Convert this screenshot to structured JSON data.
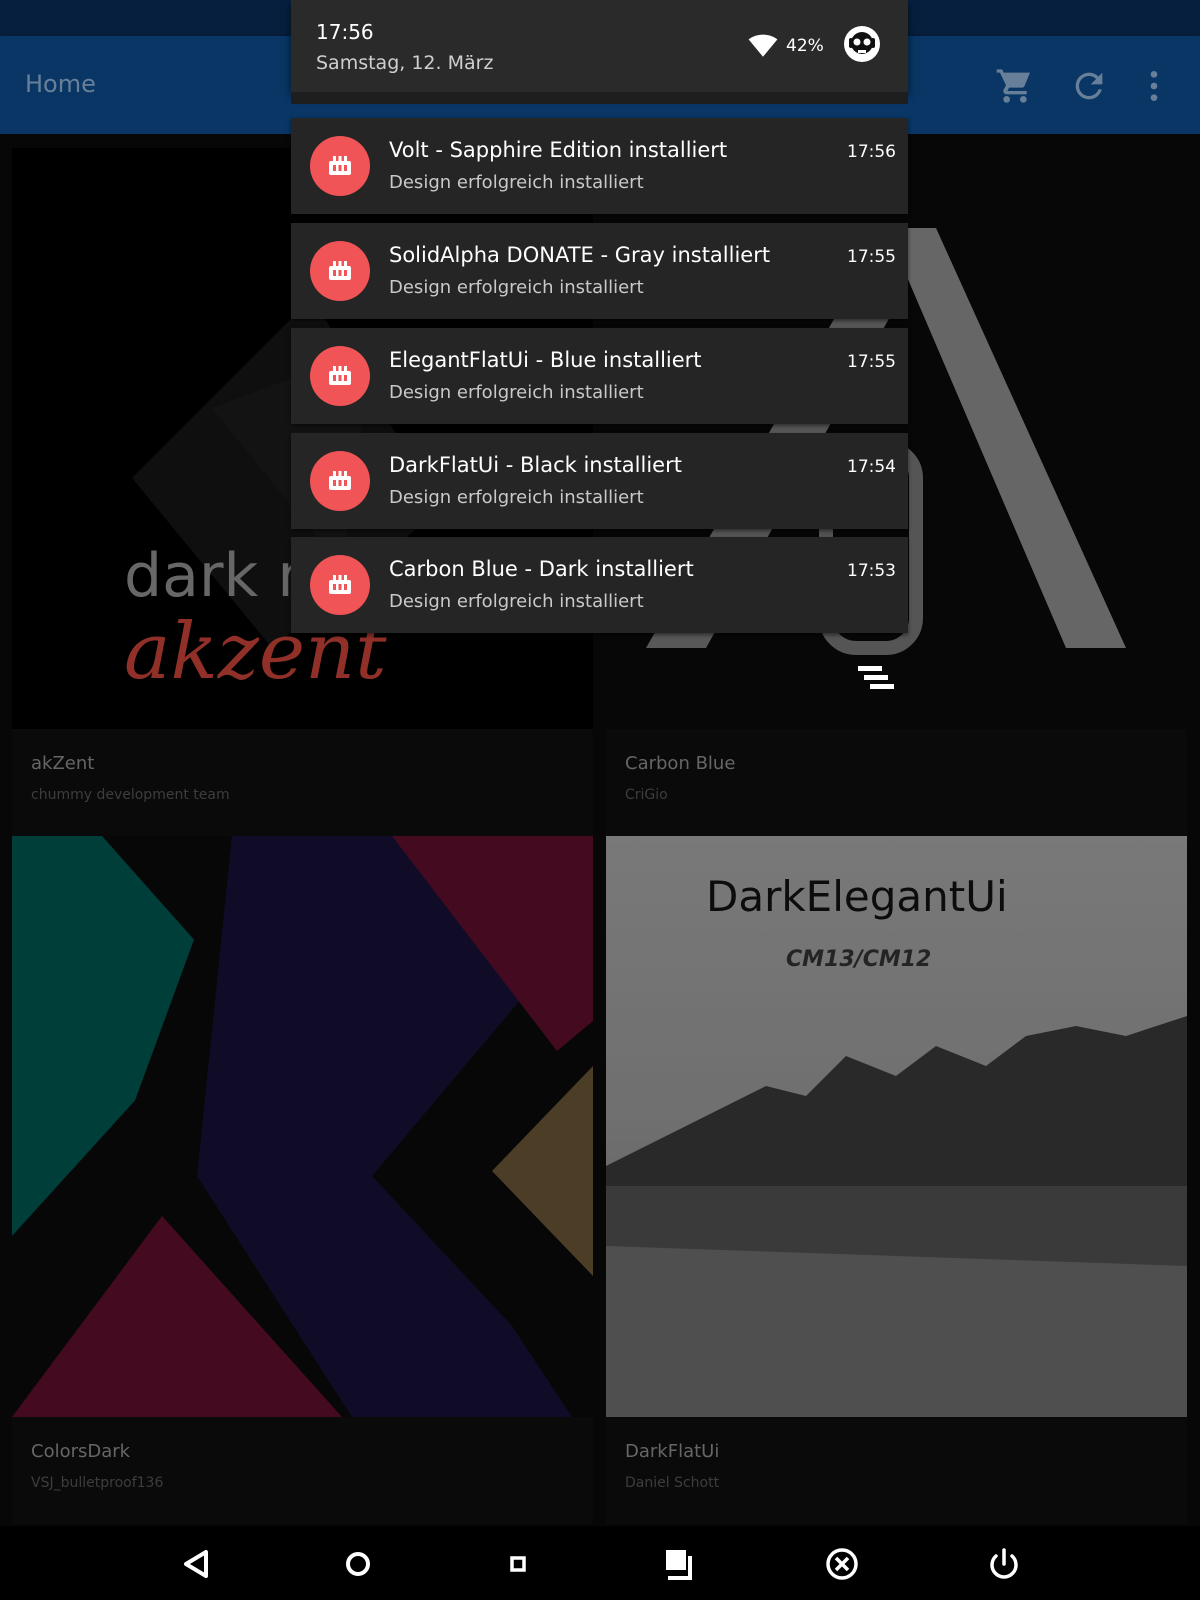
{
  "appbar": {
    "title": "Home",
    "actions": [
      {
        "icon": "cart-icon"
      },
      {
        "icon": "refresh-icon"
      },
      {
        "icon": "more-vert-icon"
      }
    ]
  },
  "shade": {
    "time": "17:56",
    "date": "Samstag, 12. März",
    "battery": "42%",
    "icons": [
      "wifi-icon",
      "avatar-icon"
    ]
  },
  "notifications": [
    {
      "title": "Volt - Sapphire Edition installiert",
      "text": "Design erfolgreich installiert",
      "time": "17:56"
    },
    {
      "title": "SolidAlpha DONATE - Gray installiert",
      "text": "Design erfolgreich installiert",
      "time": "17:55"
    },
    {
      "title": "ElegantFlatUi - Blue installiert",
      "text": "Design erfolgreich installiert",
      "time": "17:55"
    },
    {
      "title": "DarkFlatUi - Black installiert",
      "text": "Design erfolgreich installiert",
      "time": "17:54"
    },
    {
      "title": "Carbon Blue - Dark installiert",
      "text": "Design erfolgreich installiert",
      "time": "17:53"
    }
  ],
  "themes": [
    {
      "name": "akZent",
      "author": "chummy development team",
      "art_text_1": "dark m",
      "art_text_2": "akzent"
    },
    {
      "name": "Carbon Blue",
      "author": "CriGio"
    },
    {
      "name": "ColorsDark",
      "author": "VSJ_bulletproof136"
    },
    {
      "name": "DarkFlatUi",
      "author": "Daniel Schott",
      "art_title": "DarkElegantUi",
      "art_subtitle": "CM13/CM12"
    }
  ],
  "navbar": [
    "back-icon",
    "home-icon",
    "recents-icon",
    "screenshot-icon",
    "close-circle-icon",
    "power-icon"
  ],
  "colors": {
    "appbar": "#0d4b8c",
    "statusbar": "#0a2c57",
    "notification_accent": "#f05457"
  }
}
